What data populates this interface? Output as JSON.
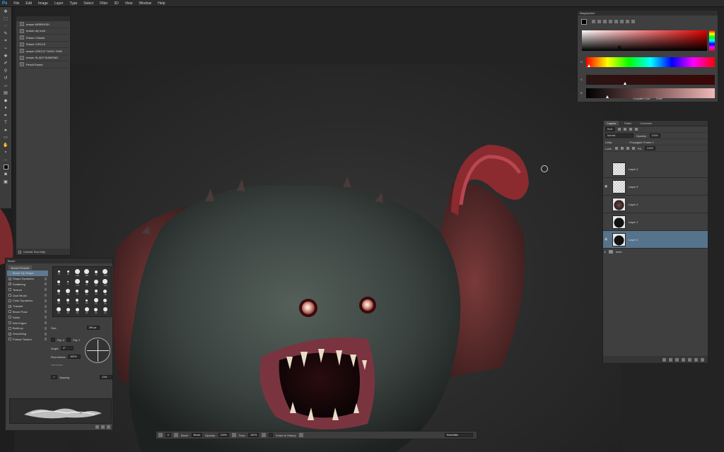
{
  "menu": {
    "logo": "Ps",
    "items": [
      "File",
      "Edit",
      "Image",
      "Layer",
      "Type",
      "Select",
      "Filter",
      "3D",
      "View",
      "Window",
      "Help"
    ]
  },
  "tool_presets": {
    "items": [
      "eraser AIRBRUSH",
      "eraser dry med",
      "Eraser Chisled",
      "Eraser CIRCLE",
      "eraser CIRCLE THICK THIN",
      "eraser SLANT DIAMOND",
      "Pencil Eraser"
    ],
    "footer_label": "Current Tool Only"
  },
  "brush_panel": {
    "title": "Brush",
    "presets_button": "Brush Presets",
    "options": [
      {
        "label": "Brush Tip Shape",
        "checked": false,
        "selected": true
      },
      {
        "label": "Shape Dynamics",
        "checked": true,
        "selected": false
      },
      {
        "label": "Scattering",
        "checked": true,
        "selected": false
      },
      {
        "label": "Texture",
        "checked": false,
        "selected": false
      },
      {
        "label": "Dual Brush",
        "checked": false,
        "selected": false
      },
      {
        "label": "Color Dynamics",
        "checked": false,
        "selected": false
      },
      {
        "label": "Transfer",
        "checked": true,
        "selected": false
      },
      {
        "label": "Brush Pose",
        "checked": false,
        "selected": false
      },
      {
        "label": "Noise",
        "checked": false,
        "selected": false
      },
      {
        "label": "Wet Edges",
        "checked": false,
        "selected": false
      },
      {
        "label": "Build-up",
        "checked": false,
        "selected": false
      },
      {
        "label": "Smoothing",
        "checked": true,
        "selected": false
      },
      {
        "label": "Protect Texture",
        "checked": false,
        "selected": false
      }
    ],
    "tips": [
      "13",
      "19",
      "100",
      "300",
      "39",
      "100",
      "25",
      "4",
      "175",
      "25",
      "65",
      "100",
      "40",
      "71",
      "25",
      "50",
      "40",
      "48",
      "25",
      "40",
      "40",
      "20",
      "63",
      "60",
      "63",
      "60",
      "60",
      "64",
      "60",
      "64"
    ],
    "size_label": "Size",
    "size_value": "390 px",
    "flip_x": "Flip X",
    "flip_y": "Flip Y",
    "angle_label": "Angle:",
    "angle_value": "0°",
    "roundness_label": "Roundness:",
    "roundness_value": "100%",
    "hardness_label": "Hardness",
    "spacing_label": "Spacing",
    "spacing_value": "11%"
  },
  "color_panel": {
    "title": "Magicpicker",
    "footer_left": "Complete Color",
    "footer_right": "Circle",
    "labels": [
      "H",
      "S",
      "B"
    ],
    "hue_pos": 0.01,
    "sat_pos": 0.3,
    "bri_pos": 0.16
  },
  "layers_panel": {
    "tabs": [
      "Layers",
      "Paths",
      "Channels"
    ],
    "kind_label": "Kind",
    "blend_mode": "Normal",
    "opacity_label": "Opacity:",
    "opacity_value": "100%",
    "unify_label": "Unify:",
    "propagate_label": "Propagate Frame 1",
    "lock_label": "Lock:",
    "fill_label": "Fill:",
    "fill_value": "100%",
    "layers": [
      {
        "name": "Layer 4",
        "thumb": "trans",
        "visible": false,
        "selected": false
      },
      {
        "name": "Layer 3",
        "thumb": "trans",
        "visible": true,
        "selected": false
      },
      {
        "name": "Layer 2",
        "thumb": "monster",
        "visible": false,
        "selected": false
      },
      {
        "name": "Layer 1",
        "thumb": "silhouette",
        "visible": false,
        "selected": false
      },
      {
        "name": "Layer 0",
        "thumb": "silhouette",
        "visible": true,
        "selected": true
      }
    ],
    "group_name": "back"
  },
  "options_bar": {
    "mode_label": "Mode:",
    "mode_value": "Brush",
    "opacity_label": "Opacity:",
    "opacity_value": "100%",
    "flow_label": "Flow:",
    "flow_value": "100%",
    "erase_history": "Erase to History",
    "preset_value": "Essentials"
  }
}
